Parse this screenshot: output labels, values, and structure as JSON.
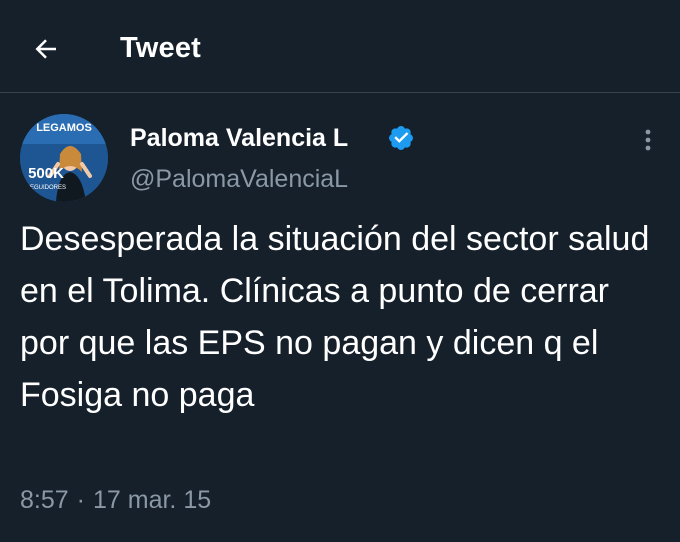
{
  "header": {
    "title": "Tweet",
    "back_icon": "arrow-left-icon"
  },
  "author": {
    "name": "Paloma Valencia L",
    "handle": "@PalomaValenciaL",
    "verified": true,
    "avatar": {
      "banner_text": "LEGAMOS",
      "badge_number": "500K",
      "badge_caption": "SEGUIDORES"
    }
  },
  "tweet": {
    "text": "Desesperada la situación del sector salud en el Tolima. Clínicas a punto de cerrar por que las EPS no pagan y dicen q el Fosiga no paga",
    "time": "8:57",
    "separator": "·",
    "date": "17 mar. 15"
  },
  "colors": {
    "background": "#15202b",
    "divider": "#38444d",
    "text_primary": "#ffffff",
    "text_secondary": "#8b98a5",
    "verified_badge": "#1d9bf0"
  }
}
